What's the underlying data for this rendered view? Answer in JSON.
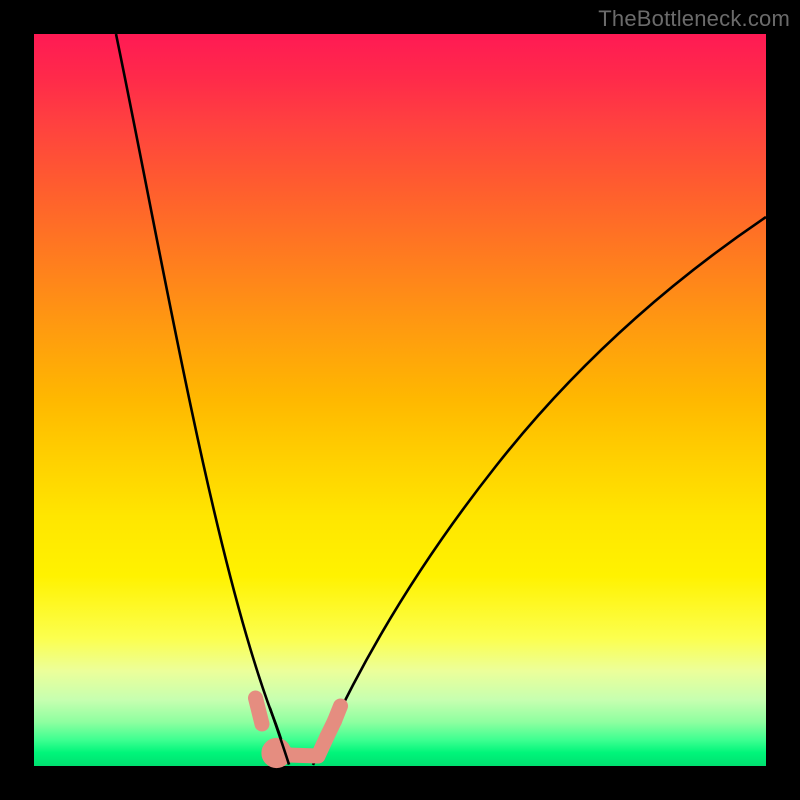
{
  "watermark": {
    "text": "TheBottleneck.com"
  },
  "colors": {
    "background": "#000000",
    "gradient_top": "#ff1a54",
    "gradient_bottom": "#00e070",
    "curve": "#000000",
    "marker": "#e58d80"
  },
  "chart_data": {
    "type": "line",
    "title": "",
    "xlabel": "",
    "ylabel": "",
    "xlim": [
      0,
      100
    ],
    "ylim": [
      0,
      100
    ],
    "grid": false,
    "series": [
      {
        "name": "left-curve",
        "x": [
          11,
          14,
          17,
          20,
          23,
          26,
          28,
          30,
          31.5,
          33,
          34.5
        ],
        "values": [
          100,
          82,
          66,
          52,
          39,
          27,
          18,
          10,
          5.5,
          2.2,
          0
        ]
      },
      {
        "name": "right-curve",
        "x": [
          38,
          40,
          43,
          47,
          52,
          58,
          65,
          73,
          82,
          91,
          100
        ],
        "values": [
          0,
          3,
          8.5,
          15.5,
          24,
          33,
          42,
          51,
          59.5,
          67.5,
          75
        ]
      }
    ],
    "markers": [
      {
        "series": "left-curve",
        "x": 30.4,
        "y": 9.0
      },
      {
        "series": "left-curve",
        "x": 31.4,
        "y": 5.4
      },
      {
        "series": "left-curve",
        "x": 33.5,
        "y": 1.6
      },
      {
        "series": "right-curve",
        "x": 35.0,
        "y": 1.3
      },
      {
        "series": "right-curve",
        "x": 37.1,
        "y": 1.2
      },
      {
        "series": "right-curve",
        "x": 39.0,
        "y": 1.6
      },
      {
        "series": "right-curve",
        "x": 40.3,
        "y": 3.9
      },
      {
        "series": "right-curve",
        "x": 41.3,
        "y": 6.1
      },
      {
        "series": "right-curve",
        "x": 42.1,
        "y": 8.1
      }
    ]
  }
}
